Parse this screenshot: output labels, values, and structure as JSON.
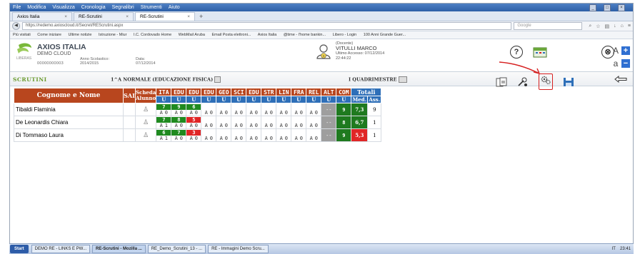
{
  "browser": {
    "menu": [
      "File",
      "Modifica",
      "Visualizza",
      "Cronologia",
      "Segnalibri",
      "Strumenti",
      "Aiuto"
    ],
    "tabs": [
      {
        "label": "Axios Italia"
      },
      {
        "label": "RE-Scrutini"
      },
      {
        "label": "RE-Scrutini"
      }
    ],
    "url": "https://redemo.axioscloud.it/Secret/REScrutini.aspx",
    "search_placeholder": "Google",
    "bookmarks": [
      "Più visitati",
      "Come iniziare",
      "Ultime notizie",
      "Istruzione - Miur",
      "I.C. Cordovado Home",
      "WebMail Aruba",
      "Email Posta elettroni...",
      "Axios Italia",
      "@time - l'home bankin...",
      "Libero - Login",
      "100 Anni Grande Guer..."
    ]
  },
  "app": {
    "brand": "AXIOS ITALIA",
    "subtitle": "DEMO CLOUD",
    "code": "00000000003",
    "year_label": "Anno Scolastico:",
    "year_value": "2014/2015",
    "date_label": "Data:",
    "date_value": "07/12/2014",
    "user_role": "(Docente)",
    "user_name": "VITULLI MARCO",
    "last_access_label": "Ultimo Accesso: 07/12/2014",
    "last_access_time": "22:44:22",
    "help_icon": "?",
    "close_icon": "⊗",
    "font_small": "A",
    "font_large": "a",
    "plus": "+",
    "minus": "−"
  },
  "scrutini": {
    "title": "SCRUTINI",
    "class_label": "1^A NORMALE (EDUCAZIONE FISICA)",
    "period_label": "I QUADRIMESTRE"
  },
  "table": {
    "headers": {
      "name": "Cognome e Nome",
      "sai": "SAI",
      "scheda": "Scheda Alunno",
      "subjects": [
        "ITA",
        "EDU",
        "EDU",
        "EDU",
        "GEO",
        "SCI",
        "EDU",
        "STR",
        "LIN",
        "FRA",
        "REL",
        "ALT",
        "COM"
      ],
      "totali": "Totali",
      "med": "Med.",
      "ass": "Ass."
    },
    "u_label": "U",
    "rows": [
      {
        "name": "Tibaldi Flaminia",
        "top": [
          "7",
          "9",
          "6",
          "",
          "",
          "",
          "",
          "",
          "",
          "",
          "",
          "",
          ""
        ],
        "bottom": [
          "A",
          "0",
          "A",
          "0",
          "A",
          "0",
          "A",
          "0",
          "A",
          "0",
          "A",
          "0",
          "A",
          "0",
          "A",
          "0",
          "A",
          "0",
          "A",
          "0",
          "A",
          "0"
        ],
        "com": "9",
        "med": "7,3",
        "ass": "9"
      },
      {
        "name": "De Leonardis Chiara",
        "top": [
          "7",
          "8",
          "5",
          "",
          "",
          "",
          "",
          "",
          "",
          "",
          "",
          "",
          ""
        ],
        "bottom": [
          "A",
          "1",
          "A",
          "0",
          "A",
          "0",
          "A",
          "0",
          "A",
          "0",
          "A",
          "0",
          "A",
          "0",
          "A",
          "0",
          "A",
          "0",
          "A",
          "0",
          "A",
          "0"
        ],
        "com": "8",
        "med": "6,7",
        "ass": "1"
      },
      {
        "name": "Di Tommaso Laura",
        "top": [
          "6",
          "7",
          "3",
          "",
          "",
          "",
          "",
          "",
          "",
          "",
          "",
          "",
          ""
        ],
        "bottom": [
          "A",
          "1",
          "A",
          "0",
          "A",
          "0",
          "A",
          "0",
          "A",
          "0",
          "A",
          "0",
          "A",
          "0",
          "A",
          "0",
          "A",
          "0",
          "A",
          "0",
          "A",
          "0"
        ],
        "com": "9",
        "med": "5,3",
        "ass": "1"
      }
    ]
  },
  "taskbar": {
    "start": "Start",
    "items": [
      "DEMO RE - LINKS E PW...",
      "RE-Scrutini - Mozilla ...",
      "RE_Demo_Scrutini_13 - ...",
      "RE - Immagini Demo Scru..."
    ],
    "clock": "23:41",
    "lang": "IT"
  },
  "colors": {
    "header_orange": "#b8461e",
    "header_blue": "#2e6fb8",
    "grade_green": "#1f8a1f",
    "grade_red": "#e02626",
    "title_green": "#6a9a2e",
    "annotation_red": "#d62020"
  }
}
